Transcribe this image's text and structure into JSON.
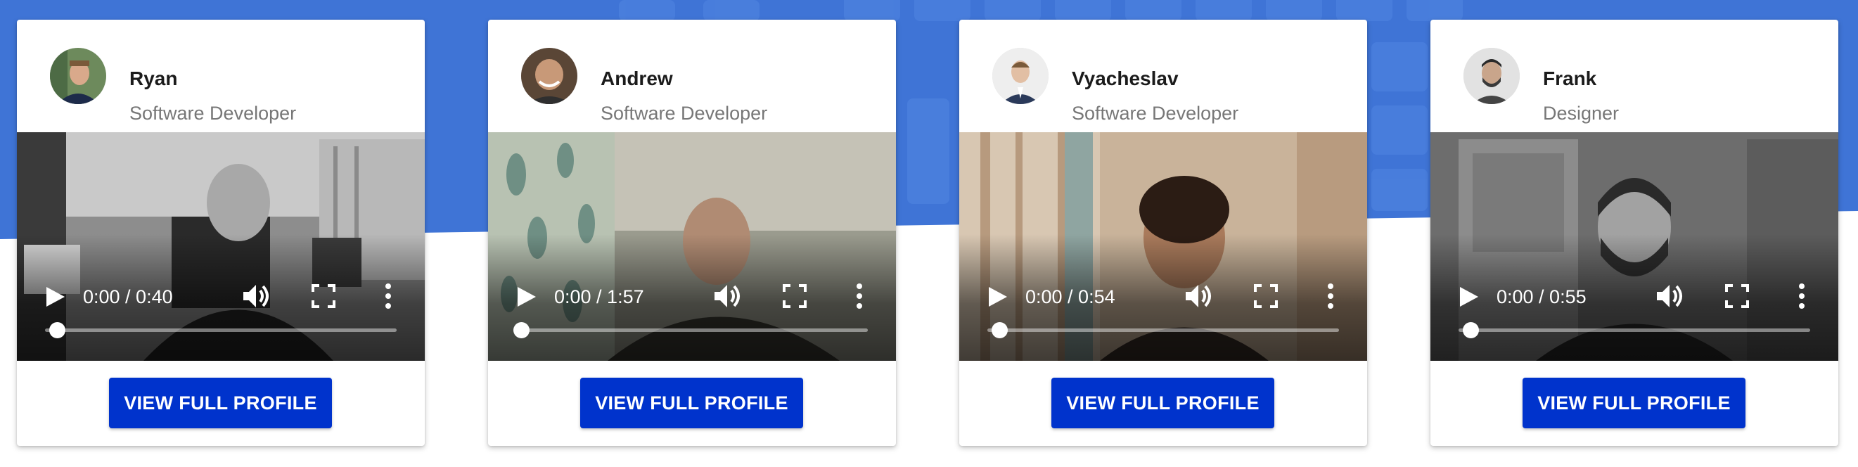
{
  "colors": {
    "band": "#3f74d6",
    "button": "#0033cc",
    "button_text": "#ffffff",
    "name": "#1b1b1b",
    "role": "#777777"
  },
  "cards": [
    {
      "name": "Ryan",
      "role": "Software Developer",
      "video": {
        "current": "0:00",
        "duration": "0:40",
        "time_text": "0:00 / 0:40",
        "progress": 0.02
      },
      "button_label": "VIEW FULL PROFILE"
    },
    {
      "name": "Andrew",
      "role": "Software Developer",
      "video": {
        "current": "0:00",
        "duration": "1:57",
        "time_text": "0:00 / 1:57",
        "progress": 0.0
      },
      "button_label": "VIEW FULL PROFILE"
    },
    {
      "name": "Vyacheslav",
      "role": "Software Developer",
      "video": {
        "current": "0:00",
        "duration": "0:54",
        "time_text": "0:00 / 0:54",
        "progress": 0.02
      },
      "button_label": "VIEW FULL PROFILE"
    },
    {
      "name": "Frank",
      "role": "Designer",
      "video": {
        "current": "0:00",
        "duration": "0:55",
        "time_text": "0:00 / 0:55",
        "progress": 0.02
      },
      "button_label": "VIEW FULL PROFILE"
    }
  ],
  "icons": {
    "play": "play-icon",
    "volume": "volume-icon",
    "fullscreen": "fullscreen-icon",
    "more": "more-vertical-icon"
  }
}
